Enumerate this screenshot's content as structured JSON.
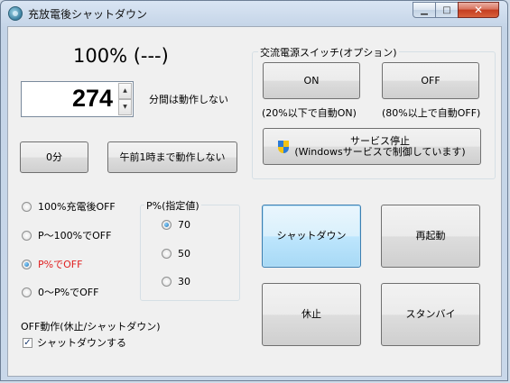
{
  "window": {
    "title": "充放電後シャットダウン",
    "icon": "app-icon",
    "minimize_glyph": "▁",
    "maximize_glyph": "□",
    "close_glyph": "✕"
  },
  "status": {
    "text": "100%  (---)"
  },
  "minutes": {
    "value": "274",
    "suffix_label": "分間は動作しない",
    "up_glyph": "▲",
    "down_glyph": "▼"
  },
  "buttons": {
    "zero_min": "0分",
    "until_1am": "午前1時まで動作しない",
    "shutdown": "シャットダウン",
    "restart": "再起動",
    "sleep": "休止",
    "standby": "スタンバイ"
  },
  "ac_switch": {
    "title": "交流電源スイッチ(オプション)",
    "on_label": "ON",
    "off_label": "OFF",
    "on_note": "(20%以下で自動ON)",
    "off_note": "(80%以上で自動OFF)",
    "service_stop_line1": "サービス停止",
    "service_stop_line2": "(Windowsサービスで制御しています)",
    "service_icon": "uac-shield-icon"
  },
  "mode_options": [
    {
      "label": "100%充電後OFF",
      "selected": false,
      "highlight": false
    },
    {
      "label": "P～100%でOFF",
      "selected": false,
      "highlight": false
    },
    {
      "label": "P%でOFF",
      "selected": true,
      "highlight": true
    },
    {
      "label": "0～P%でOFF",
      "selected": false,
      "highlight": false
    }
  ],
  "p_value": {
    "title": "P%(指定値)",
    "options": [
      {
        "label": "70",
        "selected": true
      },
      {
        "label": "50",
        "selected": false
      },
      {
        "label": "30",
        "selected": false
      }
    ]
  },
  "off_action": {
    "label": "OFF動作(休止/シャットダウン)",
    "checkbox_label": "シャットダウンする",
    "checked": true,
    "check_glyph": "✓"
  },
  "colors": {
    "highlight_text": "#e02020",
    "focus_border": "#3c7fb1",
    "close_button": "#c43d1f"
  }
}
